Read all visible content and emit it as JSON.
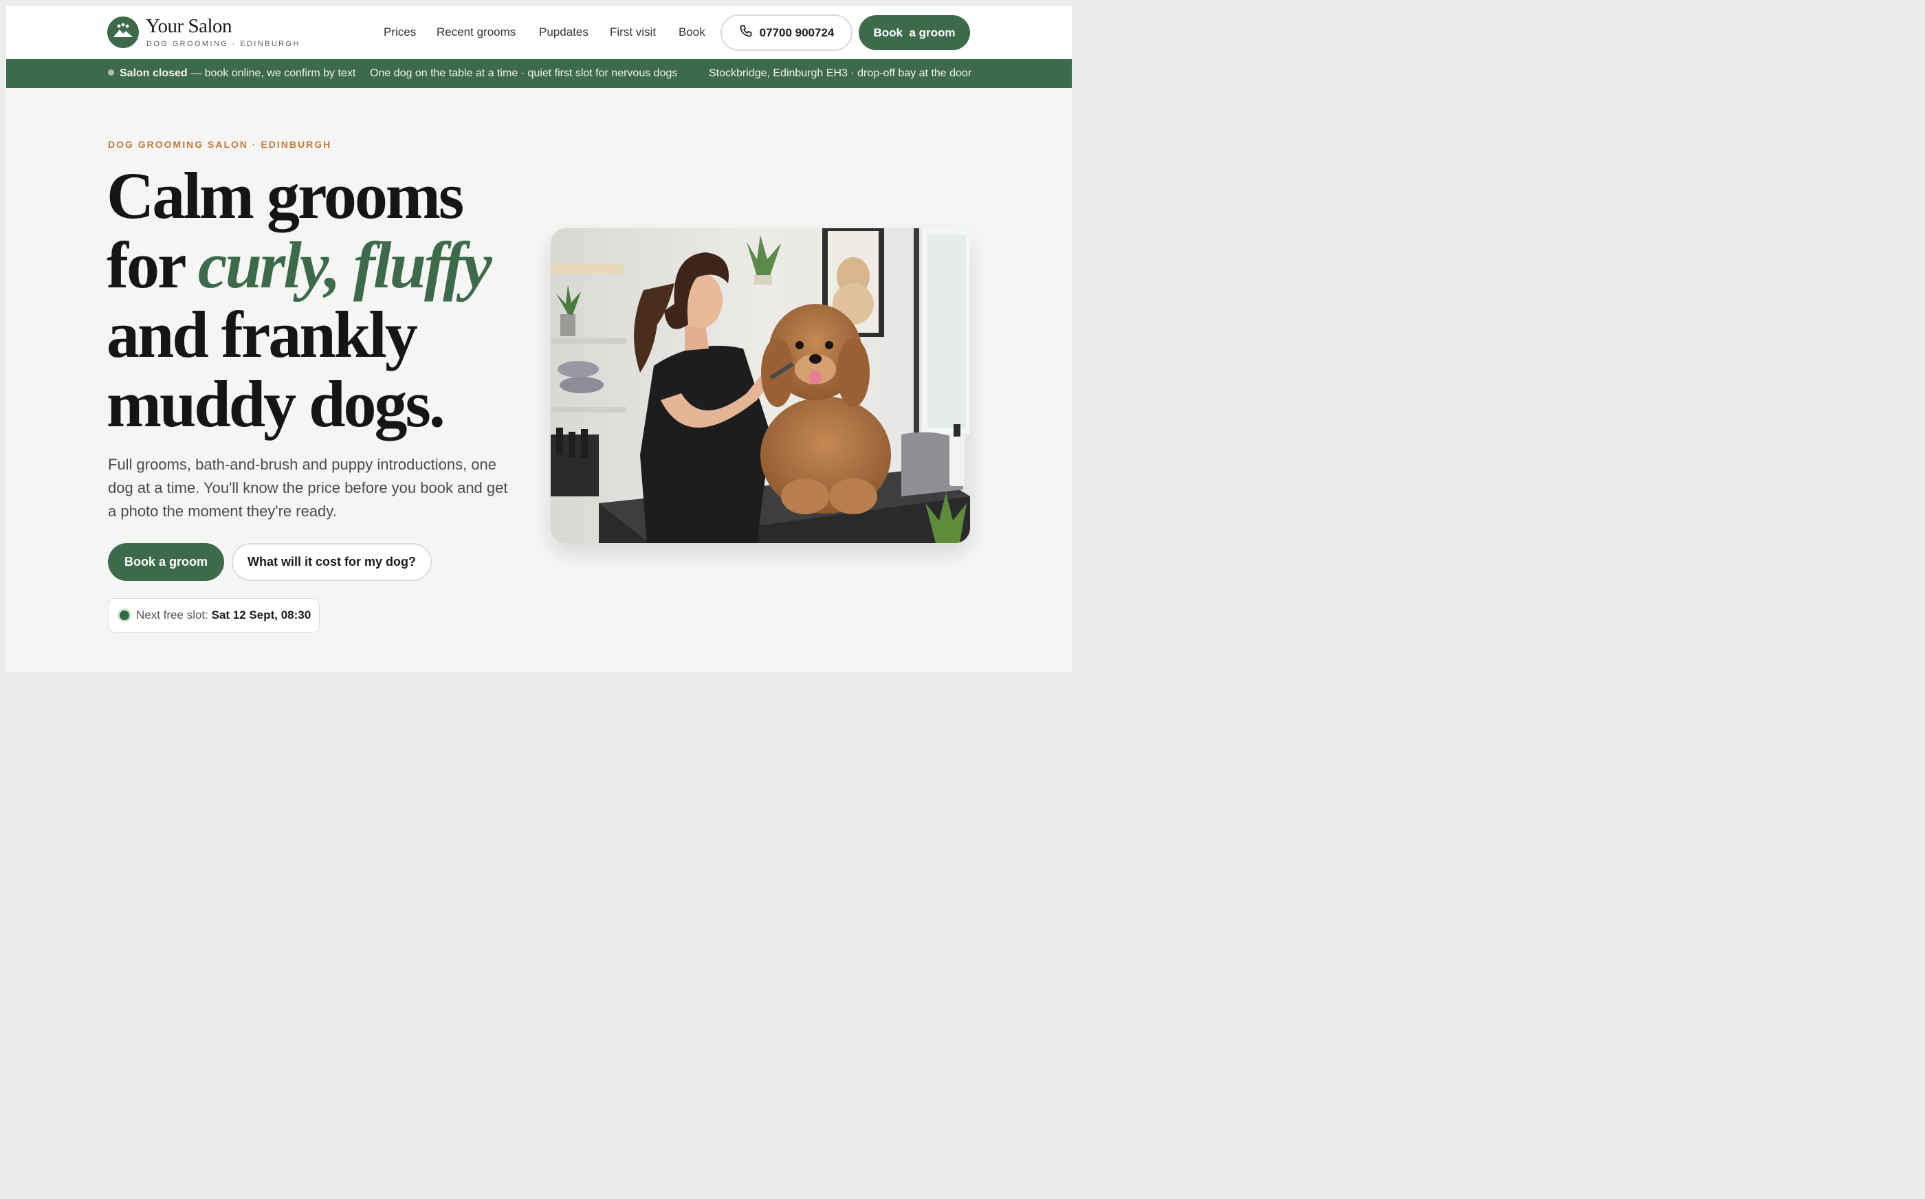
{
  "header": {
    "logo_name": "Your Salon",
    "logo_sub": "DOG GROOMING · EDINBURGH",
    "nav": [
      {
        "label": "Prices"
      },
      {
        "label": "Recent grooms"
      },
      {
        "label": "Pupdates"
      },
      {
        "label": "First visit"
      },
      {
        "label": "Book"
      }
    ],
    "phone": "07700 900724",
    "book_label": "Book  a groom"
  },
  "banner": {
    "status_bold": "Salon closed",
    "status_rest": " — book online, we confirm by text",
    "middle": "One dog on the table at a time · quiet first slot for nervous dogs",
    "right": "Stockbridge, Edinburgh EH3 · drop-off bay at the door"
  },
  "hero": {
    "eyebrow": "DOG GROOMING SALON · EDINBURGH",
    "line1": "Calm grooms",
    "line2_plain": "for ",
    "line2_accent": "curly, fluffy",
    "line3": "and frankly",
    "line4": "muddy dogs.",
    "lede": "Full grooms, bath-and-brush and puppy introductions, one dog at a time. You'll know the price before you book and get a photo the moment they're ready.",
    "cta_primary": "Book a groom",
    "cta_secondary": "What will it cost for my dog?",
    "slot_label": "Next free slot: ",
    "slot_value": "Sat 12 Sept, 08:30"
  },
  "colors": {
    "brand_green": "#3d6a4a",
    "eyebrow_orange": "#c07a3a",
    "background": "#f5f5f3"
  },
  "icons": [
    "logo-mountain-icon",
    "phone-icon",
    "status-dot-icon",
    "live-dot-icon"
  ]
}
